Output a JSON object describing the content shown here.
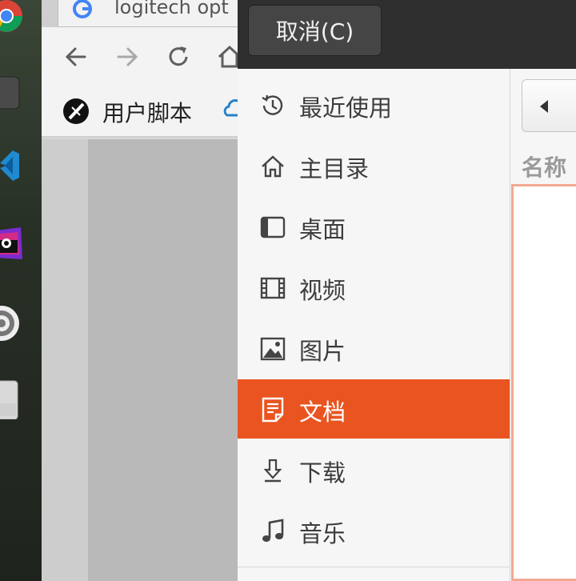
{
  "browser": {
    "tab_title": "logitech opt",
    "bookmarks": [
      {
        "label": "用户脚本",
        "icon": "tampermonkey-icon"
      }
    ]
  },
  "dialog": {
    "cancel_label": "取消(C)",
    "places": [
      {
        "label": "最近使用",
        "icon": "recent-clock-icon"
      },
      {
        "label": "主目录",
        "icon": "home-icon"
      },
      {
        "label": "桌面",
        "icon": "desktop-icon"
      },
      {
        "label": "视频",
        "icon": "film-icon"
      },
      {
        "label": "图片",
        "icon": "image-icon"
      },
      {
        "label": "文档",
        "icon": "document-icon",
        "selected": true
      },
      {
        "label": "下载",
        "icon": "download-icon"
      },
      {
        "label": "音乐",
        "icon": "music-note-icon"
      }
    ],
    "column_name_label": "名称"
  },
  "colors": {
    "accent": "#e95420",
    "headerbar": "#2f2f2f",
    "sidebar_bg": "#f6f6f6"
  }
}
